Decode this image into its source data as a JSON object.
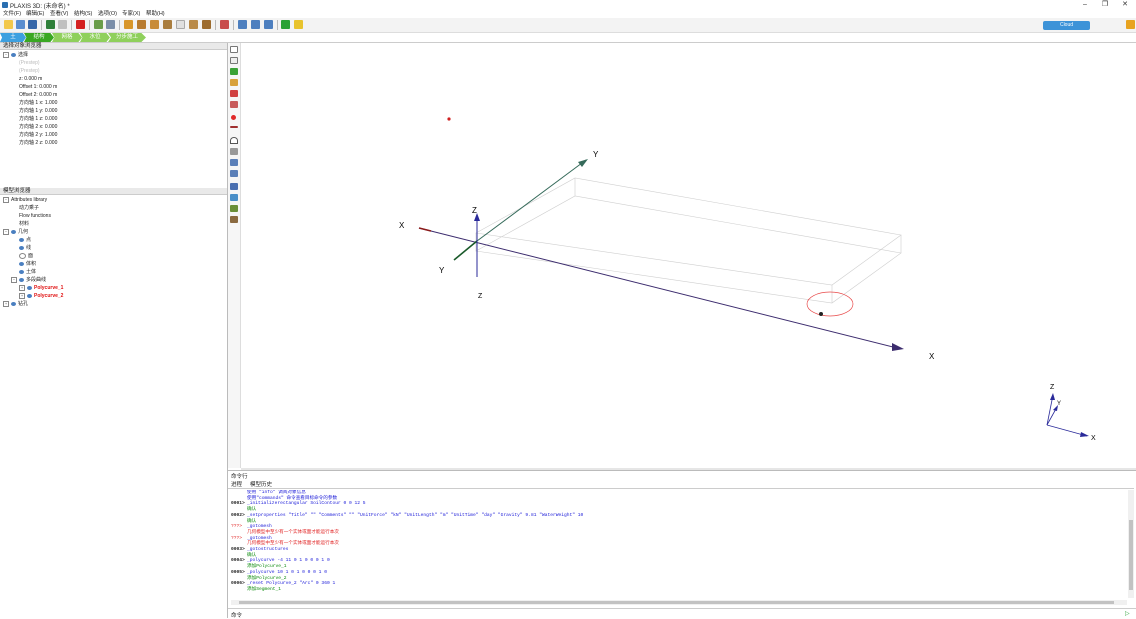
{
  "window": {
    "title": "PLAXIS 3D: (未命名) *",
    "minimize": "–",
    "restore": "❐",
    "close": "✕"
  },
  "menu": [
    "文件(F)",
    "编辑(E)",
    "查看(V)",
    "结构(S)",
    "选项(O)",
    "专家(X)",
    "帮助(H)"
  ],
  "modes": {
    "items": [
      "土",
      "结构",
      "网格",
      "水位",
      "分步施工"
    ],
    "active": 1,
    "colors": [
      "#3da0e0",
      "#5cbf2a",
      "#6fc83a",
      "#6fc83a",
      "#6fc83a"
    ]
  },
  "cloud_badge": "Cloud",
  "selection_browser": {
    "title": "选择对象浏览器",
    "root": "选择",
    "items": [
      "(Prestep)",
      "(Prestep)",
      "z: 0.000 m",
      "Offset 1: 0.000 m",
      "Offset 2: 0.000 m",
      "方向轴 1 x: 1.000",
      "方向轴 1 y: 0.000",
      "方向轴 1 z: 0.000",
      "方向轴 2 x: 0.000",
      "方向轴 2 y: 1.000",
      "方向轴 2 z: 0.000"
    ]
  },
  "model_explorer": {
    "title": "模型浏览器",
    "attributes": "Attributes library",
    "attr_children": [
      "动力乘子",
      "Flow functions",
      "材料"
    ],
    "geometry": "几何",
    "geom_children": [
      "点",
      "线",
      "面",
      "体积",
      "土体",
      "多段曲线"
    ],
    "polycurves": [
      "Polycurve_1",
      "Polycurve_2"
    ],
    "strata": "钻孔"
  },
  "viewport": {
    "axis_labels": {
      "x_neg": "X",
      "x_pos": "X",
      "y_pos": "Y",
      "y_neg": "Y",
      "z_pos": "Z",
      "z_neg": "Z"
    },
    "triad": {
      "x": "X",
      "y": "Y",
      "z": "Z"
    }
  },
  "command": {
    "title": "命令行",
    "tabs": [
      "进程",
      "模型历史"
    ],
    "lines": [
      {
        "prefix": "",
        "text": "使用 \"info\" 调阅对象信息",
        "color": "blue"
      },
      {
        "prefix": "",
        "text": "使用\"commands\" 命令查看目标命令的参数",
        "color": "blue"
      },
      {
        "prefix": "0001>",
        "text": "_initializerectangular SoilContour 0 0 12 5",
        "color": "blue"
      },
      {
        "prefix": "",
        "text": "确认",
        "color": "green"
      },
      {
        "prefix": "0002>",
        "text": "_setproperties \"Title\" \"\" \"Comments\" \"\" \"UnitForce\" \"kN\" \"UnitLength\" \"m\" \"UnitTime\" \"day\" \"Gravity\" 9.81 \"WaterWeight\" 10",
        "color": "blue"
      },
      {
        "prefix": "",
        "text": "确认",
        "color": "green"
      },
      {
        "prefix": "???>",
        "text": "_gotomesh",
        "color": "blue"
      },
      {
        "prefix": "",
        "text": "几何模型中至少有一个实体或面才能运行本次",
        "color": "red"
      },
      {
        "prefix": "???>",
        "text": "_gotomesh",
        "color": "blue"
      },
      {
        "prefix": "",
        "text": "几何模型中至少有一个实体或面才能运行本次",
        "color": "red"
      },
      {
        "prefix": "0003>",
        "text": "_gotostructures",
        "color": "blue"
      },
      {
        "prefix": "",
        "text": "确认",
        "color": "green"
      },
      {
        "prefix": "0004>",
        "text": "_polycurve -4 11 0 1 0 0 0 1 0",
        "color": "blue"
      },
      {
        "prefix": "",
        "text": "添加Polycurve_1",
        "color": "green"
      },
      {
        "prefix": "0005>",
        "text": "_polycurve 10 1 0 1 0 0 0 1 0",
        "color": "blue"
      },
      {
        "prefix": "",
        "text": "添加Polycurve_2",
        "color": "green"
      },
      {
        "prefix": "0006>",
        "text": "_reset Polycurve_2 \"Arc\" 0 360 1",
        "color": "blue"
      },
      {
        "prefix": "",
        "text": "添加Segment_1",
        "color": "green"
      }
    ],
    "input_label": "命令",
    "input_value": ""
  }
}
